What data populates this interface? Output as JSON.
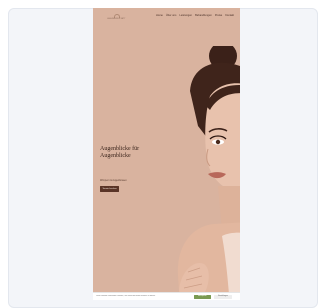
{
  "site": {
    "logo_text": "LASHWERKSTATT",
    "nav": [
      "Home",
      "Über uns",
      "Leistungen",
      "Behandlungen",
      "Preise",
      "Kontakt"
    ],
    "headline_line1": "Augenblicke für",
    "headline_line2": "Augenblicke",
    "subline": "Wimpern & Augenbrauen",
    "cta_label": "Termin buchen"
  },
  "cookie": {
    "text": "Diese Website verwendet Cookies, um Ihnen das beste Erlebnis zu bieten.",
    "accept_label": "Akzeptieren",
    "settings_label": "Einstellungen"
  },
  "colors": {
    "site_background": "#d9b39f",
    "headline": "#3a241b",
    "cta_background": "#5a3427",
    "accept_button": "#7a9a52"
  }
}
